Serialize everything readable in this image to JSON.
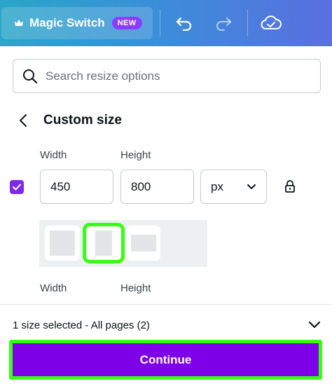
{
  "toolbar": {
    "magic_switch_label": "Magic Switch",
    "new_badge": "NEW",
    "icons": [
      "crown-icon",
      "undo-icon",
      "redo-icon",
      "cloud-check-icon"
    ]
  },
  "search": {
    "placeholder": "Search resize options"
  },
  "section": {
    "title": "Custom size"
  },
  "size": {
    "width_label": "Width",
    "height_label": "Height",
    "width_value": "450",
    "height_value": "800",
    "unit": "px",
    "checked": true
  },
  "orientation": {
    "options": [
      "square",
      "portrait",
      "landscape"
    ],
    "selected": "portrait"
  },
  "second_size": {
    "width_label": "Width",
    "height_label": "Height"
  },
  "footer": {
    "summary": "1 size selected - All pages (2)",
    "continue_label": "Continue"
  },
  "colors": {
    "accent_purple": "#7d00e8",
    "checkbox_purple": "#7d2ae8",
    "badge_purple": "#8b3dff",
    "highlight_green": "#39ff14"
  }
}
